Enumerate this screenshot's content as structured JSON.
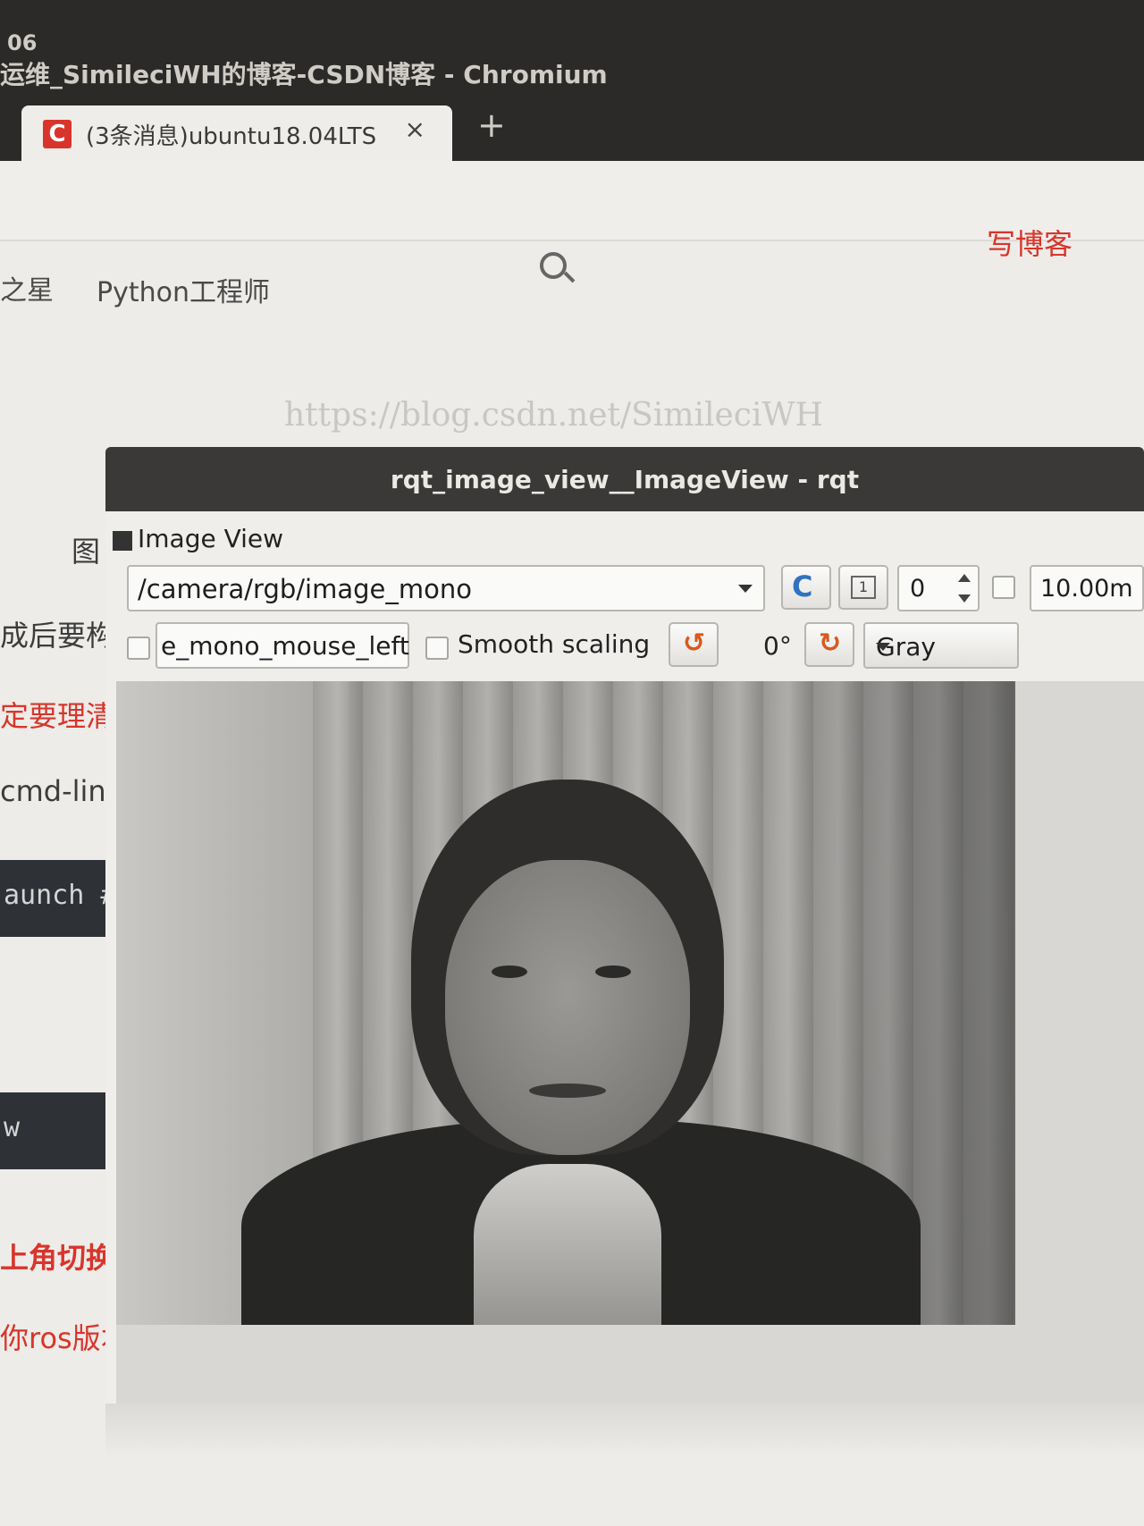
{
  "os": {
    "clock": "06",
    "window_title": "运维_SimileciWH的博客-CSDN博客 - Chromium"
  },
  "browser": {
    "tab": {
      "favicon": "C",
      "title": "(3条消息)ubuntu18.04LTS",
      "close": "×"
    },
    "new_tab": "+"
  },
  "page": {
    "nav": [
      "之星",
      "Python工程师"
    ],
    "write_blog": "写博客",
    "watermark": "https://blog.csdn.net/SimileciWH",
    "fragments": {
      "f1": "图",
      "f2": "成后要构",
      "f3": "定要理清",
      "f4": "cmd-line",
      "f5": "上角切换监",
      "f6": "你ros版本的"
    },
    "code": {
      "c1": "aunch #",
      "c2": "w"
    }
  },
  "rqt": {
    "window_title": "rqt_image_view__ImageView - rqt",
    "dock_label": "Image View",
    "topic": "/camera/rgb/image_mono",
    "refresh_icon": "C",
    "zoom_icon": "1",
    "spin_value": "0",
    "max_range": "10.00m",
    "mouse_topic": "e_mono_mouse_left",
    "smooth_scaling_label": "Smooth scaling",
    "rotate_left_icon": "↺",
    "rotation": "0°",
    "rotate_right_icon": "↻",
    "colormap": "Gray"
  },
  "colors": {
    "csdn_red": "#d9342b",
    "title_bar": "#2b2a28",
    "refresh_blue": "#2f72c0",
    "rotate_orange": "#d85a1e"
  }
}
